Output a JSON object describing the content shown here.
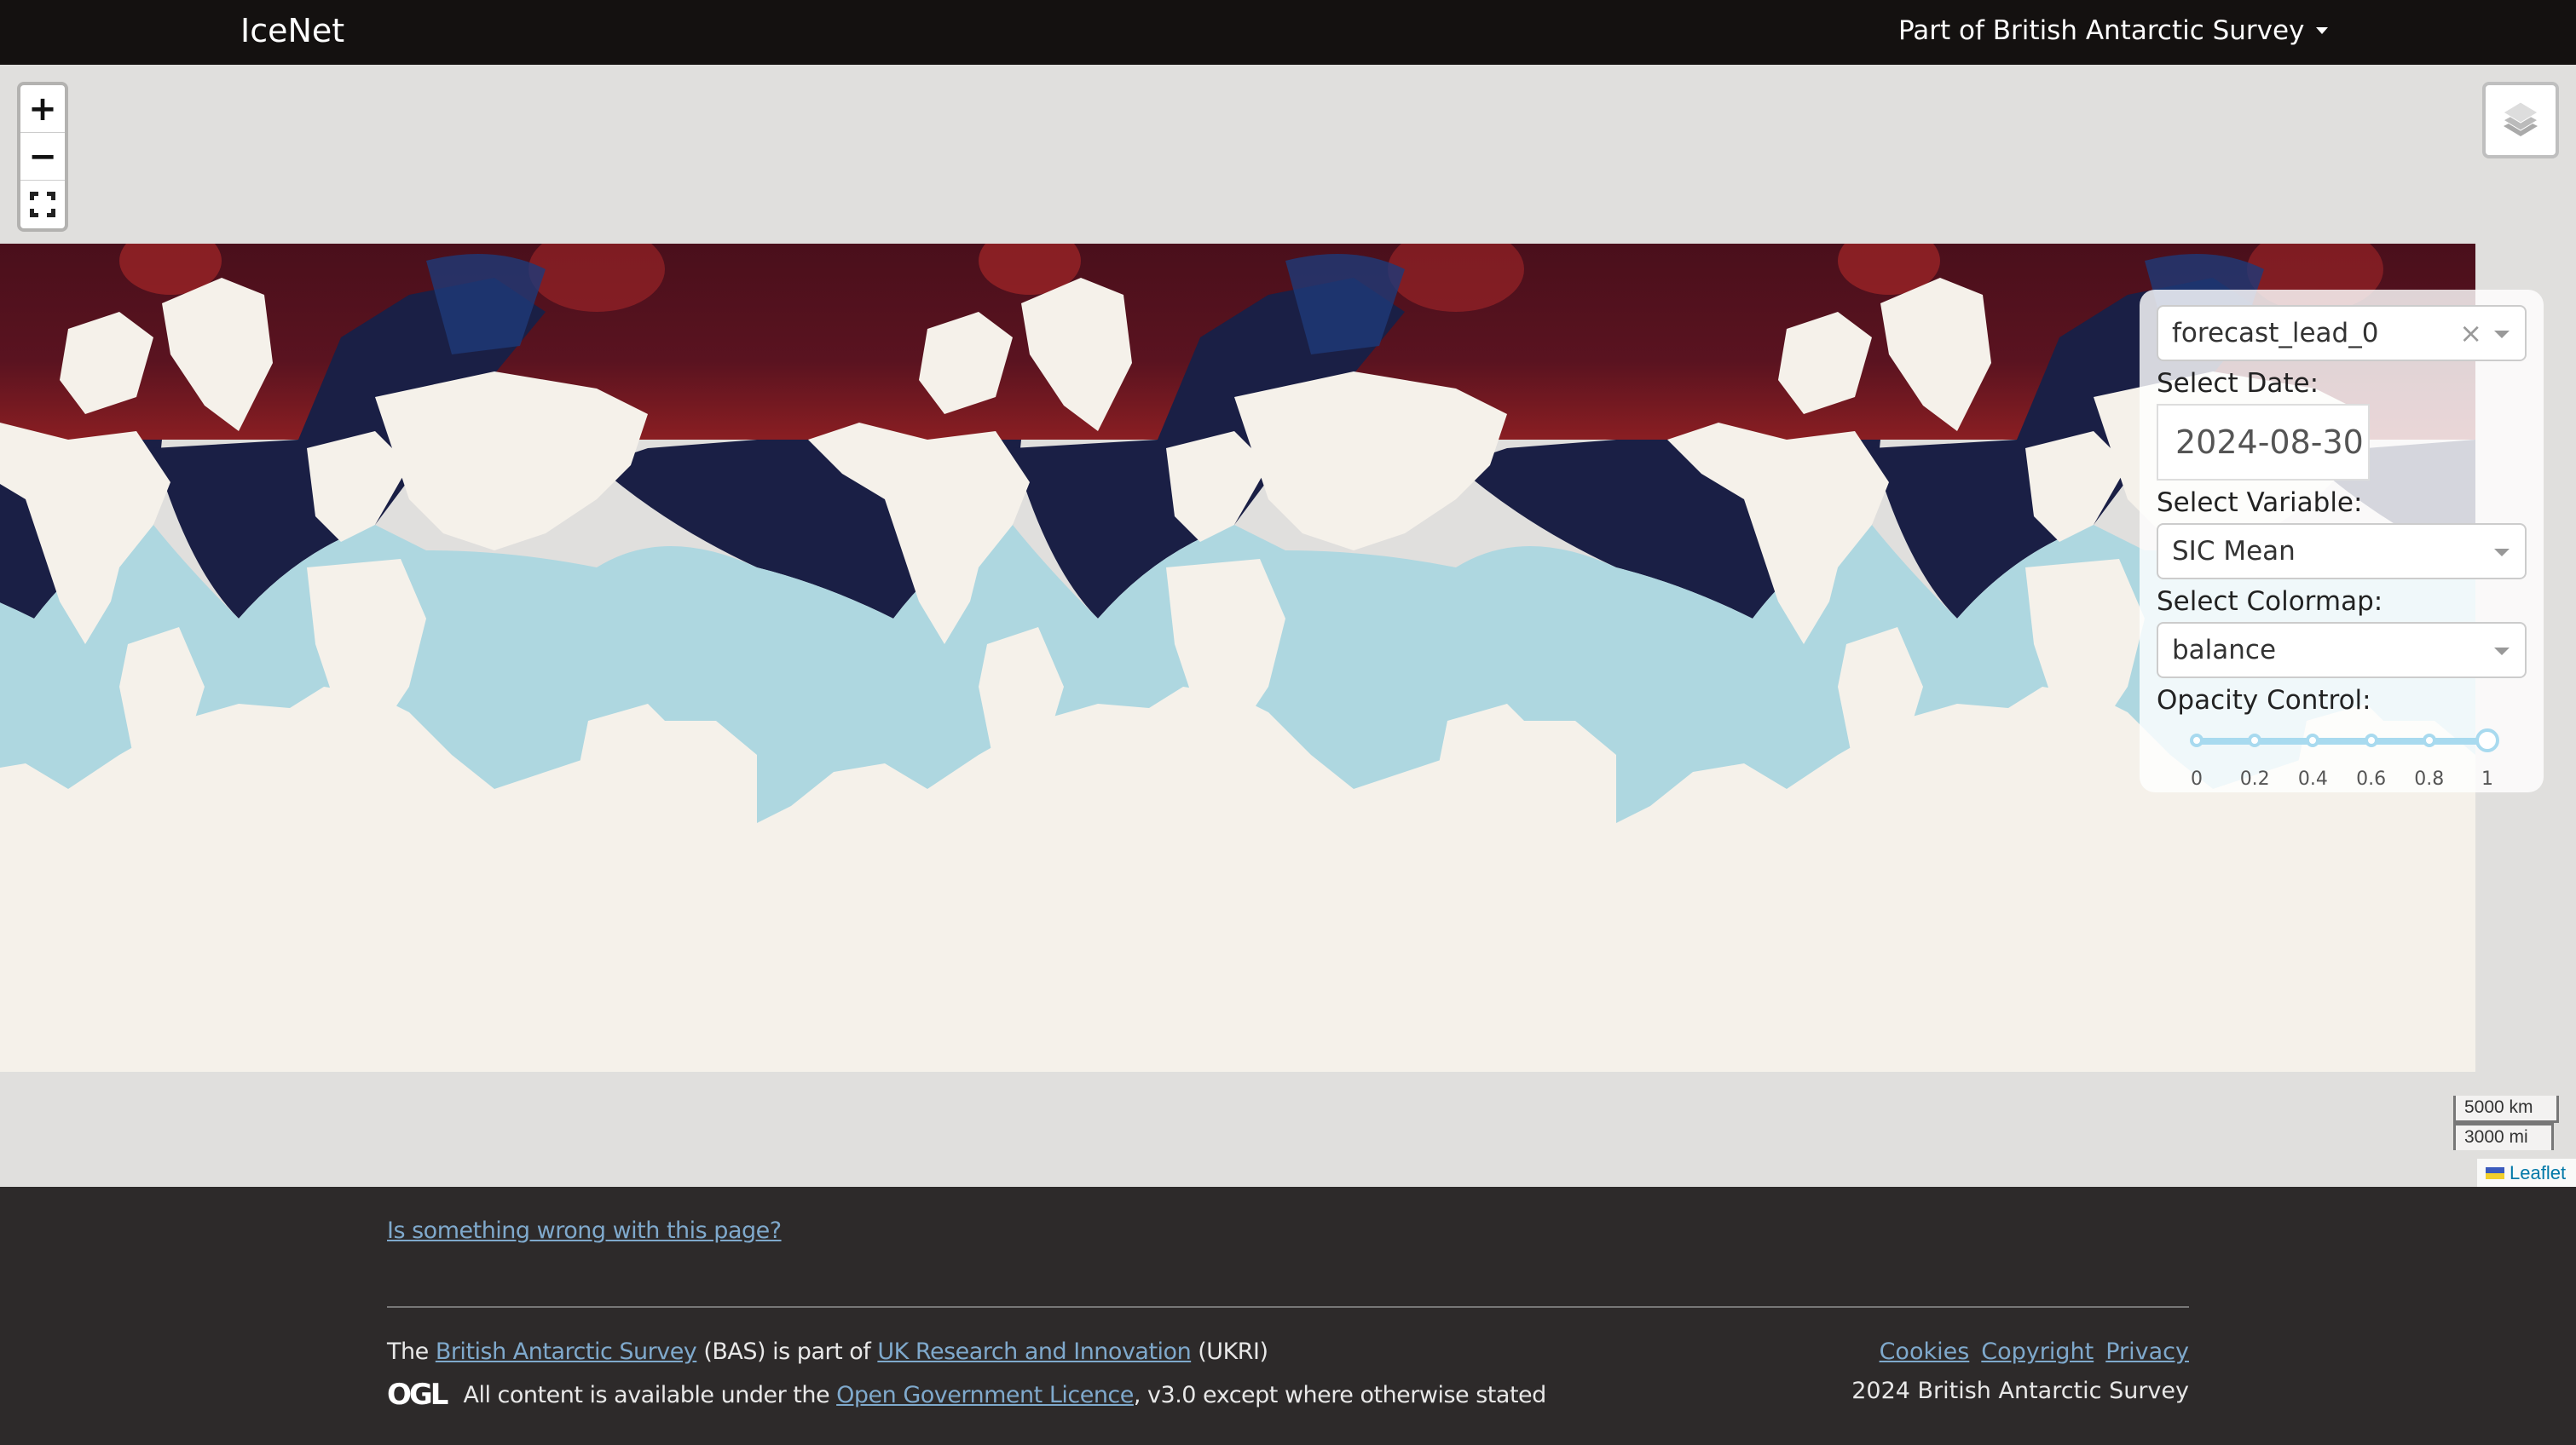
{
  "navbar": {
    "brand": "IceNet",
    "dropdown_label": "Part of British Antarctic Survey"
  },
  "map": {
    "zoom_in": "+",
    "zoom_out": "−",
    "icons": {
      "zoom_in": "plus-icon",
      "zoom_out": "minus-icon",
      "fullscreen": "fullscreen-icon",
      "layers": "layers-icon"
    },
    "colors": {
      "ocean": "#aed7e0",
      "land": "#f5f1ea",
      "ice_high": "#1a1f45",
      "ice_low": "#4a0f1b",
      "background": "#e0dfdd"
    },
    "scale": {
      "km": "5000 km",
      "mi": "3000 mi"
    },
    "attribution": "Leaflet"
  },
  "panel": {
    "forecast_select": "forecast_lead_0",
    "clear_symbol": "×",
    "date_label": "Select Date:",
    "date_value": "2024-08-30",
    "variable_label": "Select Variable:",
    "variable_value": "SIC Mean",
    "colormap_label": "Select Colormap:",
    "colormap_value": "balance",
    "opacity_label": "Opacity Control:",
    "opacity_value": 1,
    "opacity_marks": [
      "0",
      "0.2",
      "0.4",
      "0.6",
      "0.8",
      "1"
    ]
  },
  "footer": {
    "report_link": "Is something wrong with this page?",
    "line1_prefix": "The ",
    "bas_link": "British Antarctic Survey",
    "line1_mid": " (BAS) is part of ",
    "ukri_link": "UK Research and Innovation",
    "line1_suffix": " (UKRI)",
    "ogl_logo": "OGL",
    "line2_prefix": "All content is available under the ",
    "ogl_link": "Open Government Licence",
    "line2_suffix": ", v3.0 except where otherwise stated",
    "links": [
      "Cookies",
      "Copyright",
      "Privacy"
    ],
    "copyright": "2024 British Antarctic Survey"
  }
}
